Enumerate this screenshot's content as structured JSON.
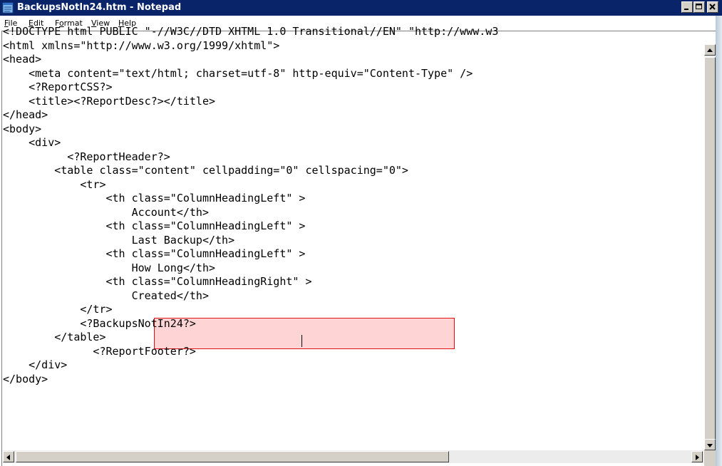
{
  "window": {
    "title": "BackupsNotIn24.htm - Notepad",
    "icon": "notepad-icon",
    "controls": [
      "minimize-icon",
      "maximize-icon",
      "close-icon"
    ]
  },
  "menu": {
    "items": [
      {
        "label": "File",
        "accel": "F",
        "rest": "ile"
      },
      {
        "label": "Edit",
        "accel": "E",
        "rest": "dit"
      },
      {
        "label": "Format",
        "pre": "F",
        "accel": "o",
        "rest": "rmat"
      },
      {
        "label": "View",
        "accel": "V",
        "rest": "iew"
      },
      {
        "label": "Help",
        "accel": "H",
        "rest": "elp"
      }
    ]
  },
  "editor": {
    "lines": [
      "<!DOCTYPE html PUBLIC \"-//W3C//DTD XHTML 1.0 Transitional//EN\" \"http://www.w3",
      "<html xmlns=\"http://www.w3.org/1999/xhtml\">",
      "<head>",
      "    <meta content=\"text/html; charset=utf-8\" http-equiv=\"Content-Type\" />",
      "    <?ReportCSS?>",
      "    <title><?ReportDesc?></title>",
      "</head>",
      "<body>",
      "    <div>",
      "          <?ReportHeader?>",
      "        <table class=\"content\" cellpadding=\"0\" cellspacing=\"0\">",
      "            <tr>",
      "                <th class=\"ColumnHeadingLeft\" >",
      "                    Account</th>",
      "                <th class=\"ColumnHeadingLeft\" >",
      "                    Last Backup</th>",
      "                <th class=\"ColumnHeadingLeft\" >",
      "                    How Long</th>",
      "                <th class=\"ColumnHeadingRight\" >",
      "                    Created</th>",
      "            </tr>",
      "            <?BackupsNotIn24?>",
      "        </table>",
      "              <?ReportFooter?>",
      "    </div>",
      "</body>"
    ],
    "highlight_color": "#e01010",
    "selection_fill": "#ffb3b3"
  },
  "colors": {
    "titlebar": "#0a246a",
    "chrome": "#d4d0c8"
  }
}
